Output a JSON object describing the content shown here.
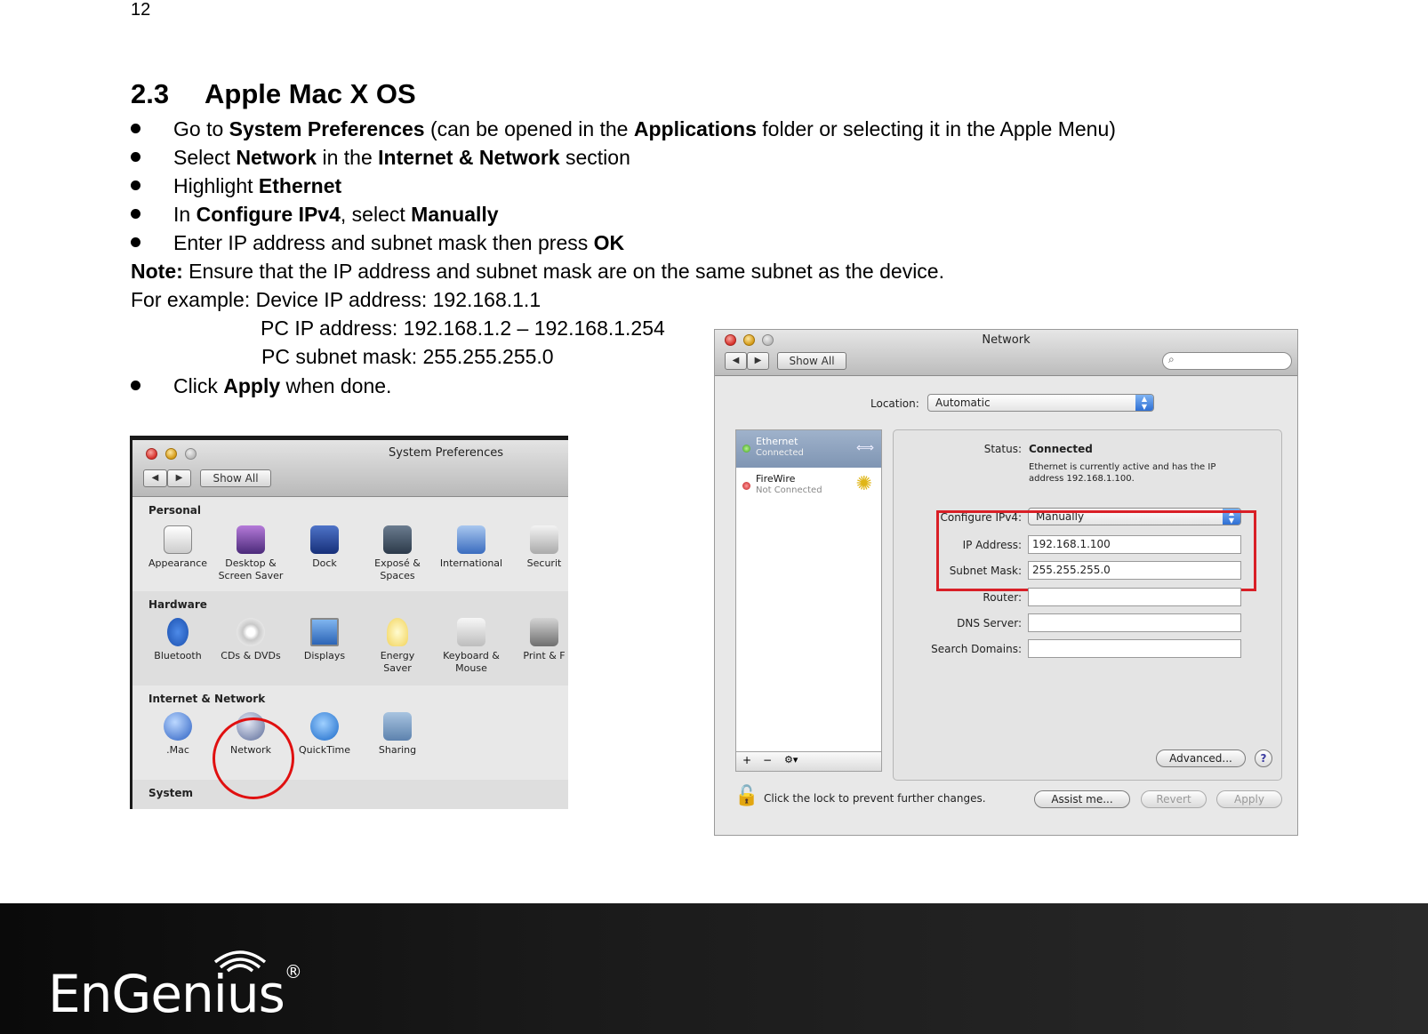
{
  "page": {
    "number": "12",
    "heading_num": "2.3",
    "heading_text": "Apple Mac X OS"
  },
  "steps": [
    {
      "pre": "Go to ",
      "b1": "System Preferences",
      "mid": " (can be opened in the ",
      "b2": "Applications",
      "post": " folder or selecting it in the Apple Menu)"
    },
    {
      "pre": "Select ",
      "b1": "Network",
      "mid": " in the ",
      "b2": "Internet & Network",
      "post": " section"
    },
    {
      "pre": "Highlight ",
      "b1": "Ethernet",
      "mid": "",
      "b2": "",
      "post": ""
    },
    {
      "pre": "In ",
      "b1": "Configure IPv4",
      "mid": ", select ",
      "b2": "Manually",
      "post": ""
    },
    {
      "pre": "Enter IP address and subnet mask then press ",
      "b1": "OK",
      "mid": "",
      "b2": "",
      "post": ""
    }
  ],
  "note": {
    "label": "Note:",
    "text": " Ensure that the IP address and subnet mask are on the same subnet as the device.",
    "example1": "For example: Device IP address: 192.168.1.1",
    "example2": "PC IP address: 192.168.1.2 – 192.168.1.254",
    "example3": "PC subnet mask: 255.255.255.0"
  },
  "final_step": {
    "pre": "Click ",
    "b1": "Apply",
    "post": " when done."
  },
  "syspref": {
    "title": "System Preferences",
    "show_all": "Show All",
    "sections": [
      {
        "header": "Personal",
        "items": [
          "Appearance",
          "Desktop &\nScreen Saver",
          "Dock",
          "Exposé &\nSpaces",
          "International",
          "Securit"
        ]
      },
      {
        "header": "Hardware",
        "items": [
          "Bluetooth",
          "CDs & DVDs",
          "Displays",
          "Energy\nSaver",
          "Keyboard &\nMouse",
          "Print & F"
        ]
      },
      {
        "header": "Internet & Network",
        "items": [
          ".Mac",
          "Network",
          "QuickTime",
          "Sharing"
        ]
      },
      {
        "header": "System",
        "items": []
      }
    ]
  },
  "network": {
    "title": "Network",
    "show_all": "Show All",
    "location_label": "Location:",
    "location_value": "Automatic",
    "services": [
      {
        "name": "Ethernet",
        "status": "Connected"
      },
      {
        "name": "FireWire",
        "status": "Not Connected"
      }
    ],
    "status_label": "Status:",
    "status_value": "Connected",
    "status_desc1": "Ethernet is currently active and has the IP",
    "status_desc2": "address 192.168.1.100.",
    "configure_label": "Configure IPv4:",
    "configure_value": "Manually",
    "ip_label": "IP Address:",
    "ip_value": "192.168.1.100",
    "mask_label": "Subnet Mask:",
    "mask_value": "255.255.255.0",
    "router_label": "Router:",
    "dns_label": "DNS Server:",
    "search_label": "Search Domains:",
    "advanced": "Advanced...",
    "help": "?",
    "lock_text": "Click the lock to prevent further changes.",
    "assist": "Assist me...",
    "revert": "Revert",
    "apply": "Apply"
  },
  "footer": {
    "logo": "EnGenius",
    "reg": "®"
  }
}
